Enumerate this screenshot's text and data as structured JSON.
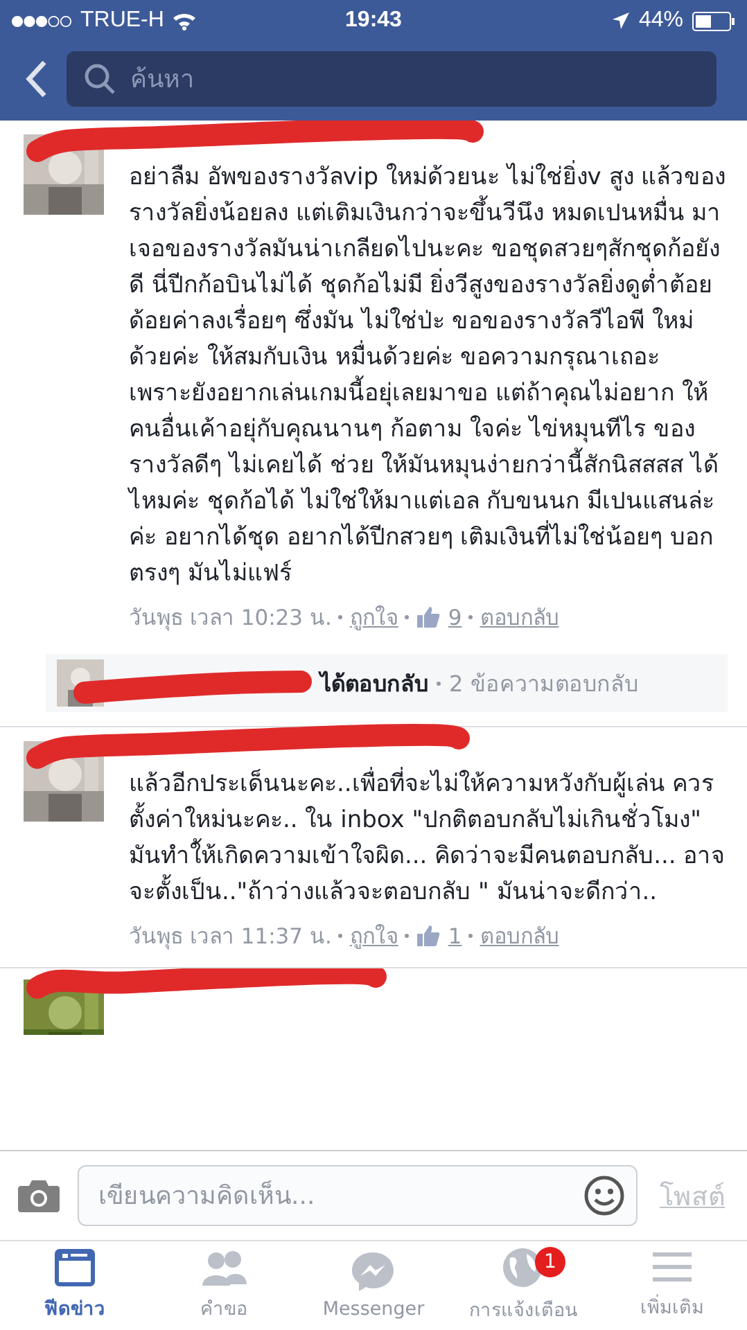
{
  "status_bar": {
    "carrier": "TRUE-H",
    "time": "19:43",
    "battery": "44%"
  },
  "search": {
    "placeholder": "ค้นหา"
  },
  "comments": [
    {
      "kind": "comment",
      "text": "อย่าลืม อัพของรางวัลvip ใหม่ด้วยนะ ไม่ใช่ยิ่งv สูง แล้วของรางวัลยิ่งน้อยลง แต่เติมเงินกว่าจะขึ้นวีนึง หมดเปนหมื่น มาเจอของรางวัลมันน่าเกลียดไปนะคะ ขอชุดสวยๆสักชุดก้อยังดี นี่ปีกก้อบินไม่ได้ ชุดก้อไม่มี ยิ่งวีสูงของรางวัลยิ่งดูต่ำต้อยด้อยค่าลงเรื่อยๆ ซึ่งมัน ไม่ใช่ป่ะ ขอของรางวัลวีไอพี ใหม่ด้วยค่ะ ให้สมกับเงิน หมื่นด้วยค่ะ ขอความกรุณาเถอะ เพราะยังอยากเล่นเกมนี้อยุ่เลยมาขอ แต่ถ้าคุณไม่อยาก ให้คนอื่นเค้าอยุ่กับคุณนานๆ ก้อตาม ใจค่ะ ไข่หมุนทีไร ของรางวัลดีๆ ไม่เคยได้ ช่วย ให้มันหมุนง่ายกว่านี้สักนิสสสส ได้ไหมค่ะ ชุดก้อได้ ไม่ใช่ให้มาแต่เอล กับขนนก มีเปนแสนล่ะค่ะ อยากได้ชุด อยากได้ปีกสวยๆ เติมเงินที่ไม่ใช่น้อยๆ บอกตรงๆ มันไม่แฟร์",
      "time": "วันพุธ เวลา 10:23 น.",
      "like": "ถูกใจ",
      "likes": "9",
      "reply": "ตอบกลับ",
      "replies": {
        "text": "ได้ตอบกลับ",
        "count": "2 ข้อความตอบกลับ"
      }
    },
    {
      "kind": "comment",
      "text": "แล้วอีกประเด็นนะคะ..เพื่อที่จะไม่ให้ความหวังกับผู้เล่น  ควรตั้งค่าใหม่นะคะ..  ใน inbox  \"ปกติตอบกลับไม่เกินชั่วโมง\"  มันทำใ้ห้เกิดความเข้าใจผิด... คิดว่าจะมีคนตอบกลับ...  อาจจะตั้งเป็น..\"ถ้าว่างแล้วจะตอบกลับ \" มันน่าจะดีกว่า..",
      "time": "วันพุธ เวลา 11:37 น.",
      "like": "ถูกใจ",
      "likes": "1",
      "reply": "ตอบกลับ"
    },
    {
      "kind": "partial"
    }
  ],
  "composer": {
    "placeholder": "เขียนความคิดเห็น...",
    "post": "โพสต์"
  },
  "tabs": [
    {
      "kind": "feed",
      "label": "ฟีดข่าว",
      "selected": true
    },
    {
      "kind": "friends",
      "label": "คำขอ",
      "selected": false
    },
    {
      "kind": "messenger",
      "label": "Messenger",
      "selected": false
    },
    {
      "kind": "globe",
      "label": "การแจ้งเตือน",
      "selected": false,
      "badge": "1"
    },
    {
      "kind": "menu",
      "label": "เพิ่มเติม",
      "selected": false
    }
  ]
}
